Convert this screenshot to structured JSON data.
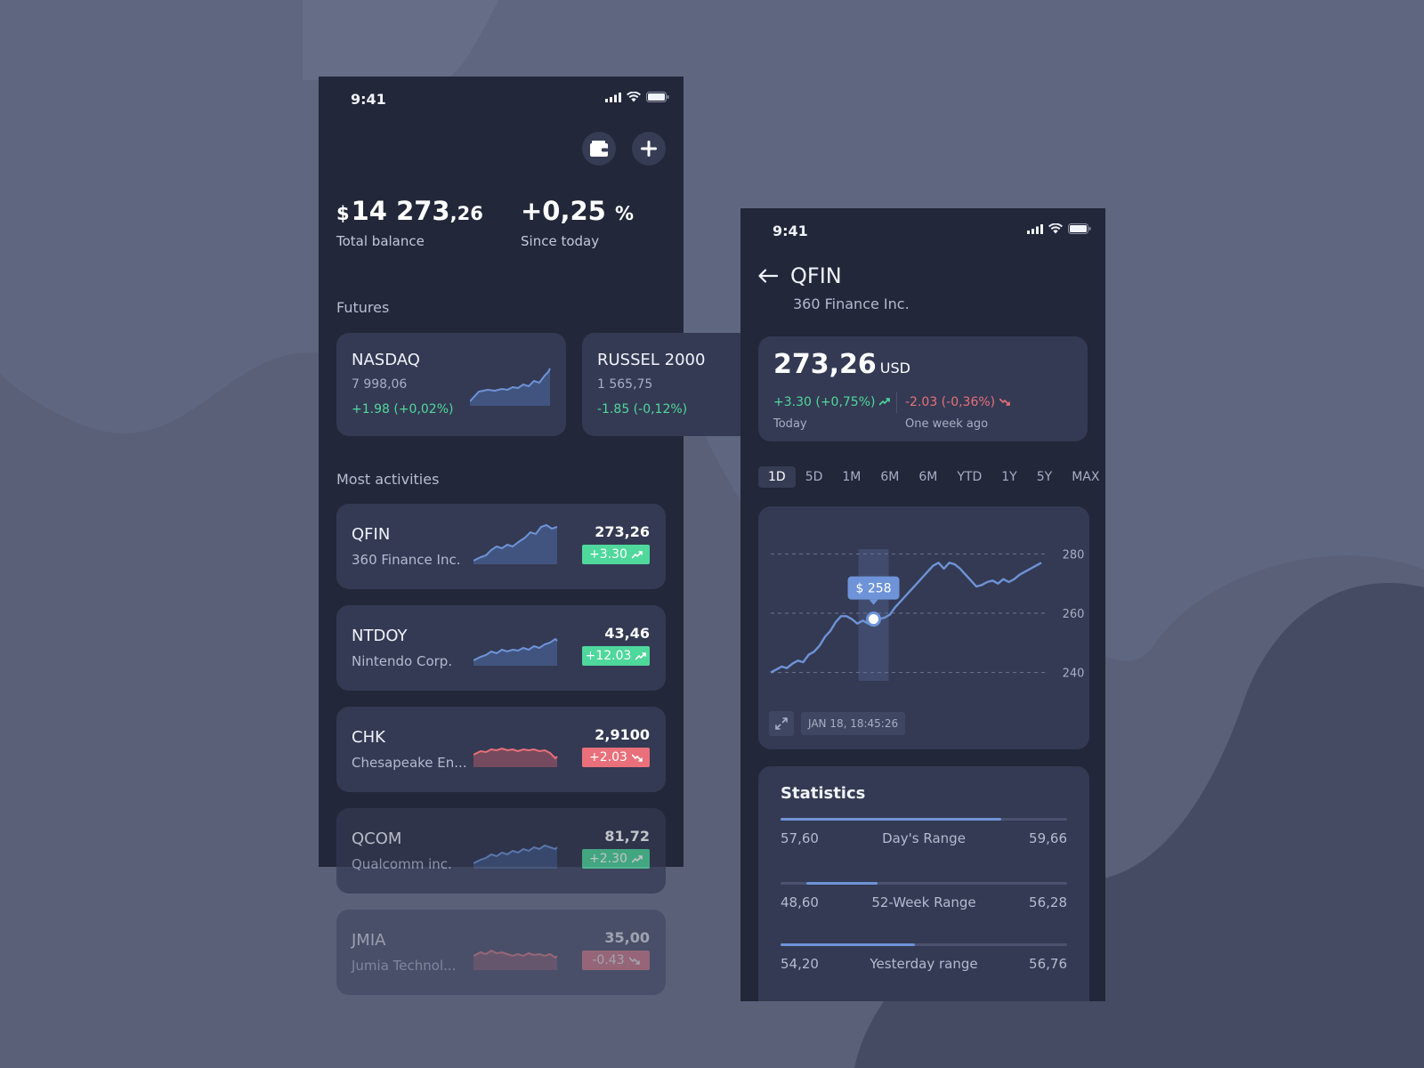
{
  "colors": {
    "background": "#5a6078",
    "panel": "#222739",
    "card": "#343a53",
    "up": "#4fd89c",
    "down": "#e9707a",
    "accent": "#6e93d8"
  },
  "left_screen": {
    "status_time": "9:41",
    "actions": [
      {
        "icon": "wallet-icon"
      },
      {
        "icon": "plus-icon"
      }
    ],
    "balance": {
      "currency": "$",
      "integer": "14 273",
      "decimals": ",26",
      "label": "Total balance"
    },
    "change": {
      "value": "+0,25",
      "unit": "%",
      "label": "Since today"
    },
    "futures_title": "Futures",
    "futures": [
      {
        "name": "NASDAQ",
        "value": "7 998,06",
        "change": "+1.98 (+0,02%)",
        "trend": "up"
      },
      {
        "name": "RUSSEL 2000",
        "value": "1 565,75",
        "change": "-1.85 (-0,12%)",
        "trend": "down"
      }
    ],
    "activities_title": "Most activities",
    "activities": [
      {
        "ticker": "QFIN",
        "name": "360 Finance Inc.",
        "price": "273,26",
        "change": "+3.30",
        "trend": "up"
      },
      {
        "ticker": "NTDOY",
        "name": "Nintendo Corp.",
        "price": "43,46",
        "change": "+12.03",
        "trend": "up"
      },
      {
        "ticker": "CHK",
        "name": "Chesapeake En...",
        "price": "2,9100",
        "change": "+2.03",
        "trend": "down"
      },
      {
        "ticker": "QCOM",
        "name": "Qualcomm inc.",
        "price": "81,72",
        "change": "+2.30",
        "trend": "up"
      },
      {
        "ticker": "JMIA",
        "name": "Jumia Technol...",
        "price": "35,00",
        "change": "-0.43",
        "trend": "down"
      }
    ]
  },
  "right_screen": {
    "status_time": "9:41",
    "ticker": "QFIN",
    "company": "360 Finance Inc.",
    "price": "273,26",
    "currency": "USD",
    "change_today": "+3.30 (+0,75%)",
    "change_today_label": "Today",
    "change_week": "-2.03 (-0,36%)",
    "change_week_label": "One week ago",
    "ranges": [
      "1D",
      "5D",
      "1M",
      "6M",
      "6M",
      "YTD",
      "1Y",
      "5Y",
      "MAX"
    ],
    "active_range": "1D",
    "chart": {
      "tooltip": "$ 258",
      "y_ticks": [
        "280",
        "260",
        "240"
      ],
      "timestamp": "JAN 18, 18:45:26"
    },
    "statistics_title": "Statistics",
    "statistics": [
      {
        "low": "57,60",
        "label": "Day's Range",
        "high": "59,66",
        "fill_start": 0.0,
        "fill_end": 0.77
      },
      {
        "low": "48,60",
        "label": "52-Week Range",
        "high": "56,28",
        "fill_start": 0.09,
        "fill_end": 0.34
      },
      {
        "low": "54,20",
        "label": "Yesterday range",
        "high": "56,76",
        "fill_start": 0.0,
        "fill_end": 0.47
      }
    ]
  },
  "chart_data": {
    "type": "line",
    "y_ticks": [
      280,
      260,
      240
    ],
    "ylim": [
      236,
      284
    ],
    "x": [
      0,
      1,
      2,
      3,
      4,
      5,
      6,
      7,
      8,
      9,
      10,
      11,
      12,
      13,
      14,
      15,
      16,
      17,
      18,
      19,
      20,
      21,
      22,
      23,
      24,
      25,
      26,
      27,
      28,
      29,
      30,
      31,
      32,
      33,
      34,
      35,
      36,
      37,
      38,
      39,
      40,
      41,
      42,
      43,
      44,
      45,
      46,
      47,
      48,
      49,
      50
    ],
    "values": [
      240,
      241,
      242,
      241.5,
      243,
      244,
      243.5,
      246,
      247,
      249,
      252,
      254,
      257,
      259,
      259,
      258,
      256.5,
      257.5,
      256.5,
      257.5,
      258,
      258.5,
      259.5,
      262,
      264,
      266,
      268,
      270,
      272,
      274,
      276,
      277,
      275,
      277,
      276.5,
      275,
      273,
      271,
      269,
      269.5,
      270.5,
      271,
      270,
      271.5,
      270.5,
      271.5,
      273,
      274,
      275,
      276,
      277
    ],
    "highlight_index": 19,
    "highlight_value": 258
  }
}
